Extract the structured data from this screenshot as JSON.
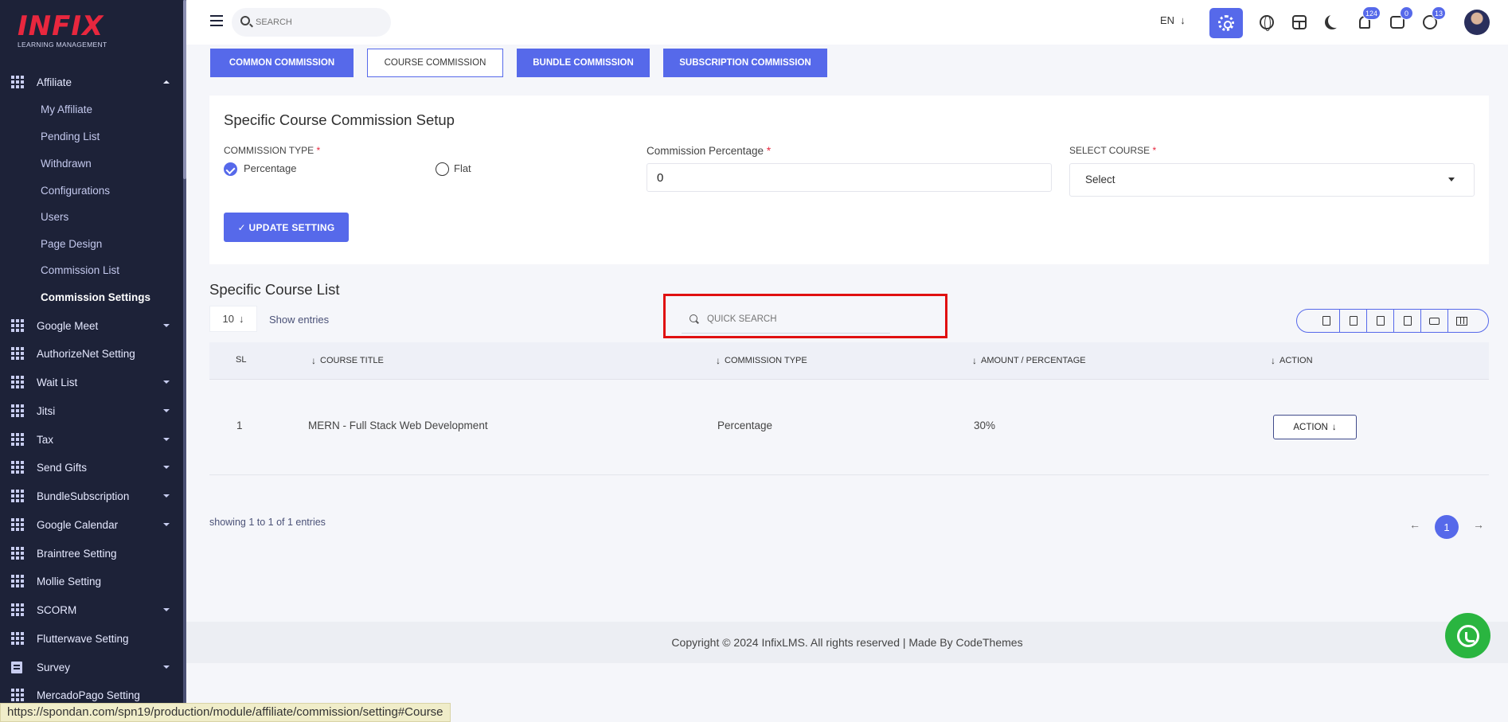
{
  "brand": {
    "logo_word": "INFIX",
    "logo_sub": "LEARNING MANAGEMENT",
    "accent": "#5669ea",
    "logo_red": "#e8273e"
  },
  "sidebar": {
    "affiliate": {
      "label": "Affiliate",
      "sub_items": [
        "My Affiliate",
        "Pending List",
        "Withdrawn",
        "Configurations",
        "Users",
        "Page Design",
        "Commission List",
        "Commission Settings"
      ],
      "active": "Commission Settings"
    },
    "groups": [
      "Google Meet",
      "AuthorizeNet Setting",
      "Wait List",
      "Jitsi",
      "Tax",
      "Send Gifts",
      "BundleSubscription",
      "Google Calendar",
      "Braintree Setting",
      "Mollie Setting",
      "SCORM",
      "Flutterwave Setting",
      "Survey",
      "MercadoPago Setting"
    ]
  },
  "header": {
    "search_placeholder": "SEARCH",
    "language": "EN",
    "notifications_count": "124",
    "messages_count": "0",
    "whatsapp_count": "13"
  },
  "tabs": [
    "COMMON COMMISSION",
    "COURSE COMMISSION",
    "BUNDLE COMMISSION",
    "SUBSCRIPTION COMMISSION"
  ],
  "setup": {
    "title": "Specific Course Commission Setup",
    "commission_type_label": "COMMISSION TYPE",
    "required_mark": "*",
    "option_percentage": "Percentage",
    "option_flat": "Flat",
    "percentage_label": "Commission Percentage",
    "percentage_value": "0",
    "select_course_label": "SELECT COURSE",
    "select_value": "Select",
    "update_button": "✓ UPDATE SETTING"
  },
  "list": {
    "title": "Specific Course List",
    "entries_value": "10",
    "show_entries": "Show entries",
    "quick_search_placeholder": "QUICK SEARCH",
    "columns": [
      "SL",
      "COURSE TITLE",
      "COMMISSION TYPE",
      "AMOUNT / PERCENTAGE",
      "ACTION"
    ],
    "rows": [
      {
        "sl": "1",
        "title": "MERN - Full Stack Web Development",
        "type": "Percentage",
        "amount": "30%",
        "action": "ACTION"
      }
    ],
    "showing": "showing 1 to 1 of 1 entries",
    "current_page": "1"
  },
  "footer": {
    "copyright": "Copyright © 2024 InfixLMS. All rights reserved | Made By CodeThemes"
  },
  "status_bar": {
    "url": "https://spondan.com/spn19/production/module/affiliate/commission/setting#Course"
  }
}
